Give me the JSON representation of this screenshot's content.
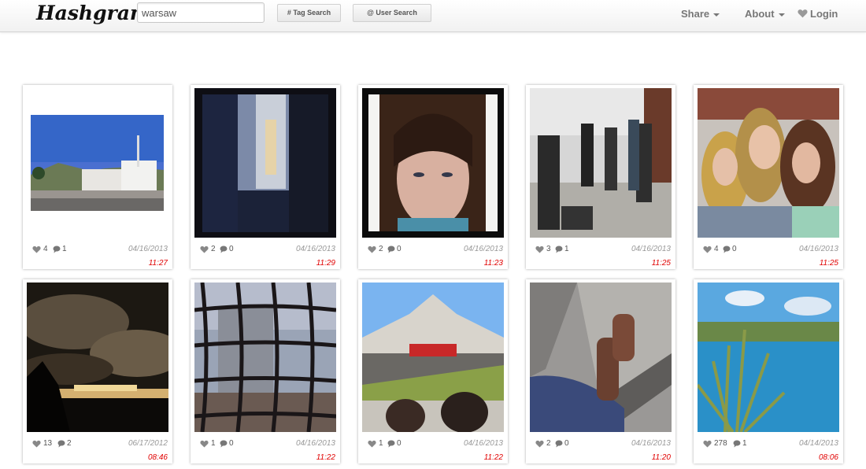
{
  "header": {
    "brand": "Hashgram",
    "search_value": "warsaw",
    "tag_search_label": "# Tag Search",
    "user_search_label": "@ User Search",
    "share_label": "Share",
    "about_label": "About",
    "login_label": "Login"
  },
  "colors": {
    "time": "#e00000",
    "date": "#999999",
    "heart": "#888888"
  },
  "posts": [
    {
      "likes": "4",
      "comments": "1",
      "date": "04/16/2013",
      "time": "11:27"
    },
    {
      "likes": "2",
      "comments": "0",
      "date": "04/16/2013",
      "time": "11:29"
    },
    {
      "likes": "2",
      "comments": "0",
      "date": "04/16/2013",
      "time": "11:23"
    },
    {
      "likes": "3",
      "comments": "1",
      "date": "04/16/2013",
      "time": "11:25"
    },
    {
      "likes": "4",
      "comments": "0",
      "date": "04/16/2013",
      "time": "11:25"
    },
    {
      "likes": "13",
      "comments": "2",
      "date": "06/17/2012",
      "time": "08:46"
    },
    {
      "likes": "1",
      "comments": "0",
      "date": "04/16/2013",
      "time": "11:22"
    },
    {
      "likes": "1",
      "comments": "0",
      "date": "04/16/2013",
      "time": "11:22"
    },
    {
      "likes": "2",
      "comments": "0",
      "date": "04/16/2013",
      "time": "11:20"
    },
    {
      "likes": "278",
      "comments": "1",
      "date": "04/14/2013",
      "time": "08:06"
    }
  ]
}
